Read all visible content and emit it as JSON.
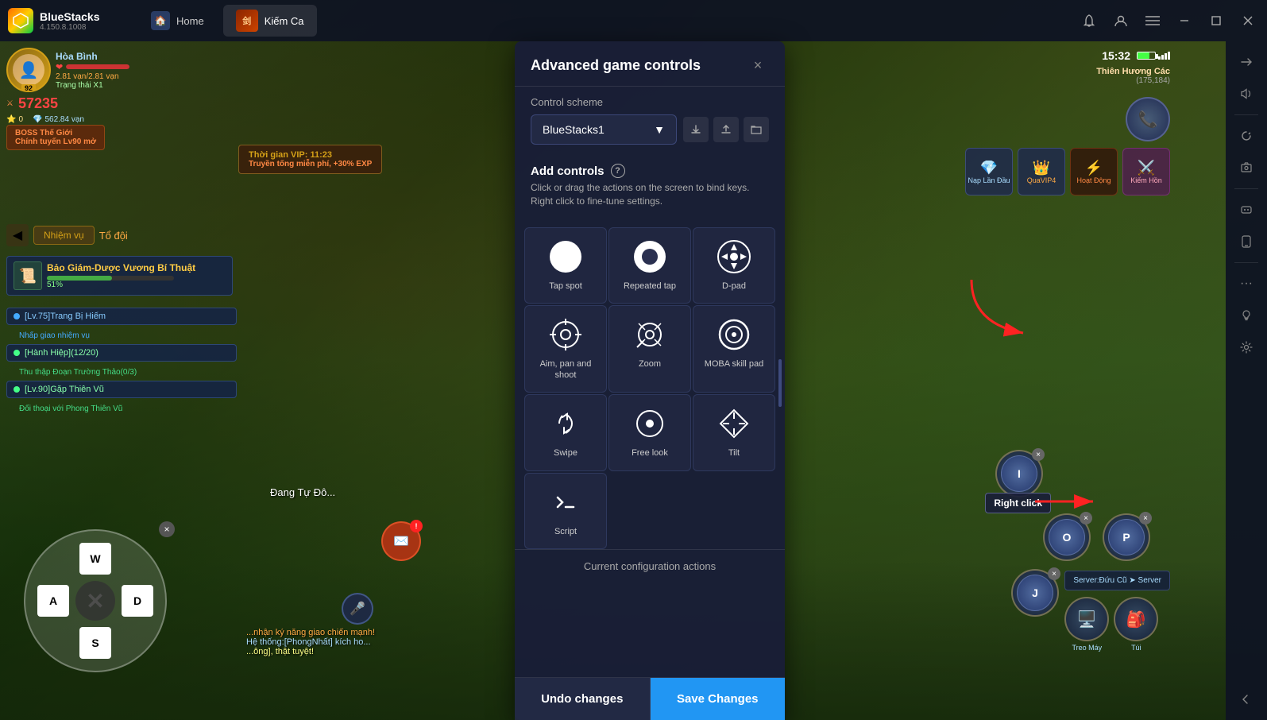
{
  "app": {
    "name": "BlueStacks",
    "version": "4.150.8.1008",
    "logo_text": "B"
  },
  "tabs": [
    {
      "id": "home",
      "label": "Home",
      "active": false
    },
    {
      "id": "kiem-ca",
      "label": "Kiếm Ca",
      "active": true
    }
  ],
  "top_right": {
    "time": "15:32"
  },
  "panel": {
    "title": "Advanced game controls",
    "scheme_label": "Control scheme",
    "scheme_value": "BlueStacks1",
    "add_controls_title": "Add controls",
    "add_controls_desc": "Click or drag the actions on the screen to bind keys. Right click to fine-tune settings.",
    "controls": [
      {
        "id": "tap-spot",
        "label": "Tap spot",
        "icon": "circle"
      },
      {
        "id": "repeated-tap",
        "label": "Repeated tap",
        "icon": "repeat-circle"
      },
      {
        "id": "d-pad",
        "label": "D-pad",
        "icon": "dpad"
      },
      {
        "id": "aim-pan-shoot",
        "label": "Aim, pan and shoot",
        "icon": "aim"
      },
      {
        "id": "zoom",
        "label": "Zoom",
        "icon": "zoom"
      },
      {
        "id": "moba-skill-pad",
        "label": "MOBA skill pad",
        "icon": "moba"
      },
      {
        "id": "swipe",
        "label": "Swipe",
        "icon": "swipe"
      },
      {
        "id": "free-look",
        "label": "Free look",
        "icon": "eye-circle"
      },
      {
        "id": "tilt",
        "label": "Tilt",
        "icon": "diamond"
      },
      {
        "id": "script",
        "label": "Script",
        "icon": "code"
      }
    ],
    "current_config_label": "Current configuration actions",
    "footer": {
      "undo_label": "Undo changes",
      "save_label": "Save Changes"
    }
  },
  "dpad": {
    "keys": {
      "up": "W",
      "down": "S",
      "left": "A",
      "right": "D"
    }
  },
  "right_click_label": "Right click",
  "annotations": {
    "repeated_tap_arrow": true,
    "right_click_arrow": true
  },
  "hud": {
    "level": "92",
    "combat_power": "57235",
    "gold": "0",
    "silver": "562.84 vạn",
    "hp_bar": "2.81 vạn/2.81 vạn",
    "status": "Trạng thái X1",
    "player_name": "Hòa Bình",
    "vip_text": "Thời gian VIP: 11:23",
    "bonus_text": "Truyền tống miễn phí, +30% EXP",
    "server_text": "Thiên Hương Các",
    "coords": "(175,184)",
    "quest_items": [
      {
        "level": "[Lv.75]Trang Bị Hiếm",
        "action": "Nhấp giao nhiệm vụ",
        "color": "blue"
      },
      {
        "level": "[Hành Hiệp](12/20)",
        "action": "",
        "color": "green"
      },
      {
        "level": "Thu thập Đoạn Trường Thảo(0/3)",
        "action": "",
        "color": "blue"
      },
      {
        "level": "[Lv.90]Gặp Thiên Vũ",
        "action": "Đối thoại với Phong Thiên Vũ",
        "color": "green"
      }
    ]
  },
  "skill_keys": [
    {
      "key": "O",
      "row": 1,
      "col": 2
    },
    {
      "key": "P",
      "row": 1,
      "col": 3
    },
    {
      "key": "I",
      "row": 2,
      "col": 1
    },
    {
      "key": "J",
      "row": 3,
      "col": 1
    }
  ]
}
